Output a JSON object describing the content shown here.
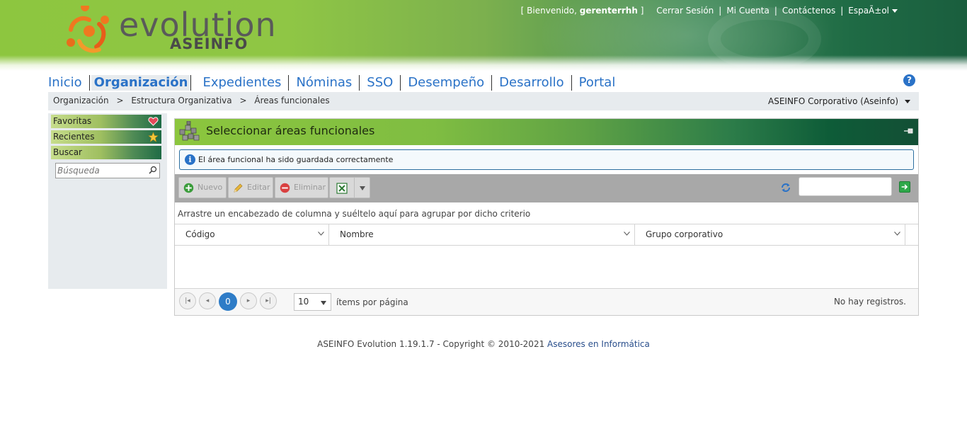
{
  "brand": {
    "name": "evolution",
    "sub": "ASEINFO",
    "colors": {
      "green": "#8dc63f",
      "dark_green": "#1a5e3e",
      "orange": "#f07820",
      "blue": "#2a72c7"
    }
  },
  "header": {
    "welcome_prefix": "[ Bienvenido,",
    "username": "gerenterrhh",
    "welcome_suffix": "]",
    "logout": "Cerrar Sesión",
    "account": "Mi Cuenta",
    "contact": "Contáctenos",
    "language": "EspaÃ±ol"
  },
  "nav": {
    "items": [
      {
        "label": "Inicio"
      },
      {
        "label": "Organización",
        "active": true
      },
      {
        "label": "Expedientes"
      },
      {
        "label": "Nóminas"
      },
      {
        "label": "SSO"
      },
      {
        "label": "Desempeño"
      },
      {
        "label": "Desarrollo"
      },
      {
        "label": "Portal"
      }
    ],
    "help_icon": "help-icon"
  },
  "breadcrumb": {
    "items": [
      "Organización",
      "Estructura Organizativa",
      "Áreas funcionales"
    ],
    "separator": ">",
    "company": "ASEINFO Corporativo (Aseinfo)"
  },
  "sidebar": {
    "favorites": "Favoritas",
    "recent": "Recientes",
    "search": "Buscar",
    "search_placeholder": "Búsqueda"
  },
  "panel": {
    "title": "Seleccionar áreas funcionales",
    "alert": "El área funcional ha sido guardada correctamente",
    "toolbar": {
      "new": "Nuevo",
      "edit": "Editar",
      "delete": "Eliminar"
    },
    "group_hint": "Arrastre un encabezado de columna y suéltelo aquí para agrupar por dicho criterio",
    "columns": [
      "Código",
      "Nombre",
      "Grupo corporativo"
    ],
    "rows": [],
    "pager": {
      "current_page": "0",
      "page_size": "10",
      "per_page_label": "ítems por página",
      "info": "No hay registros."
    }
  },
  "footer": {
    "text": "ASEINFO Evolution 1.19.1.7 - Copyright © 2010-2021",
    "link": "Asesores en Informática"
  }
}
